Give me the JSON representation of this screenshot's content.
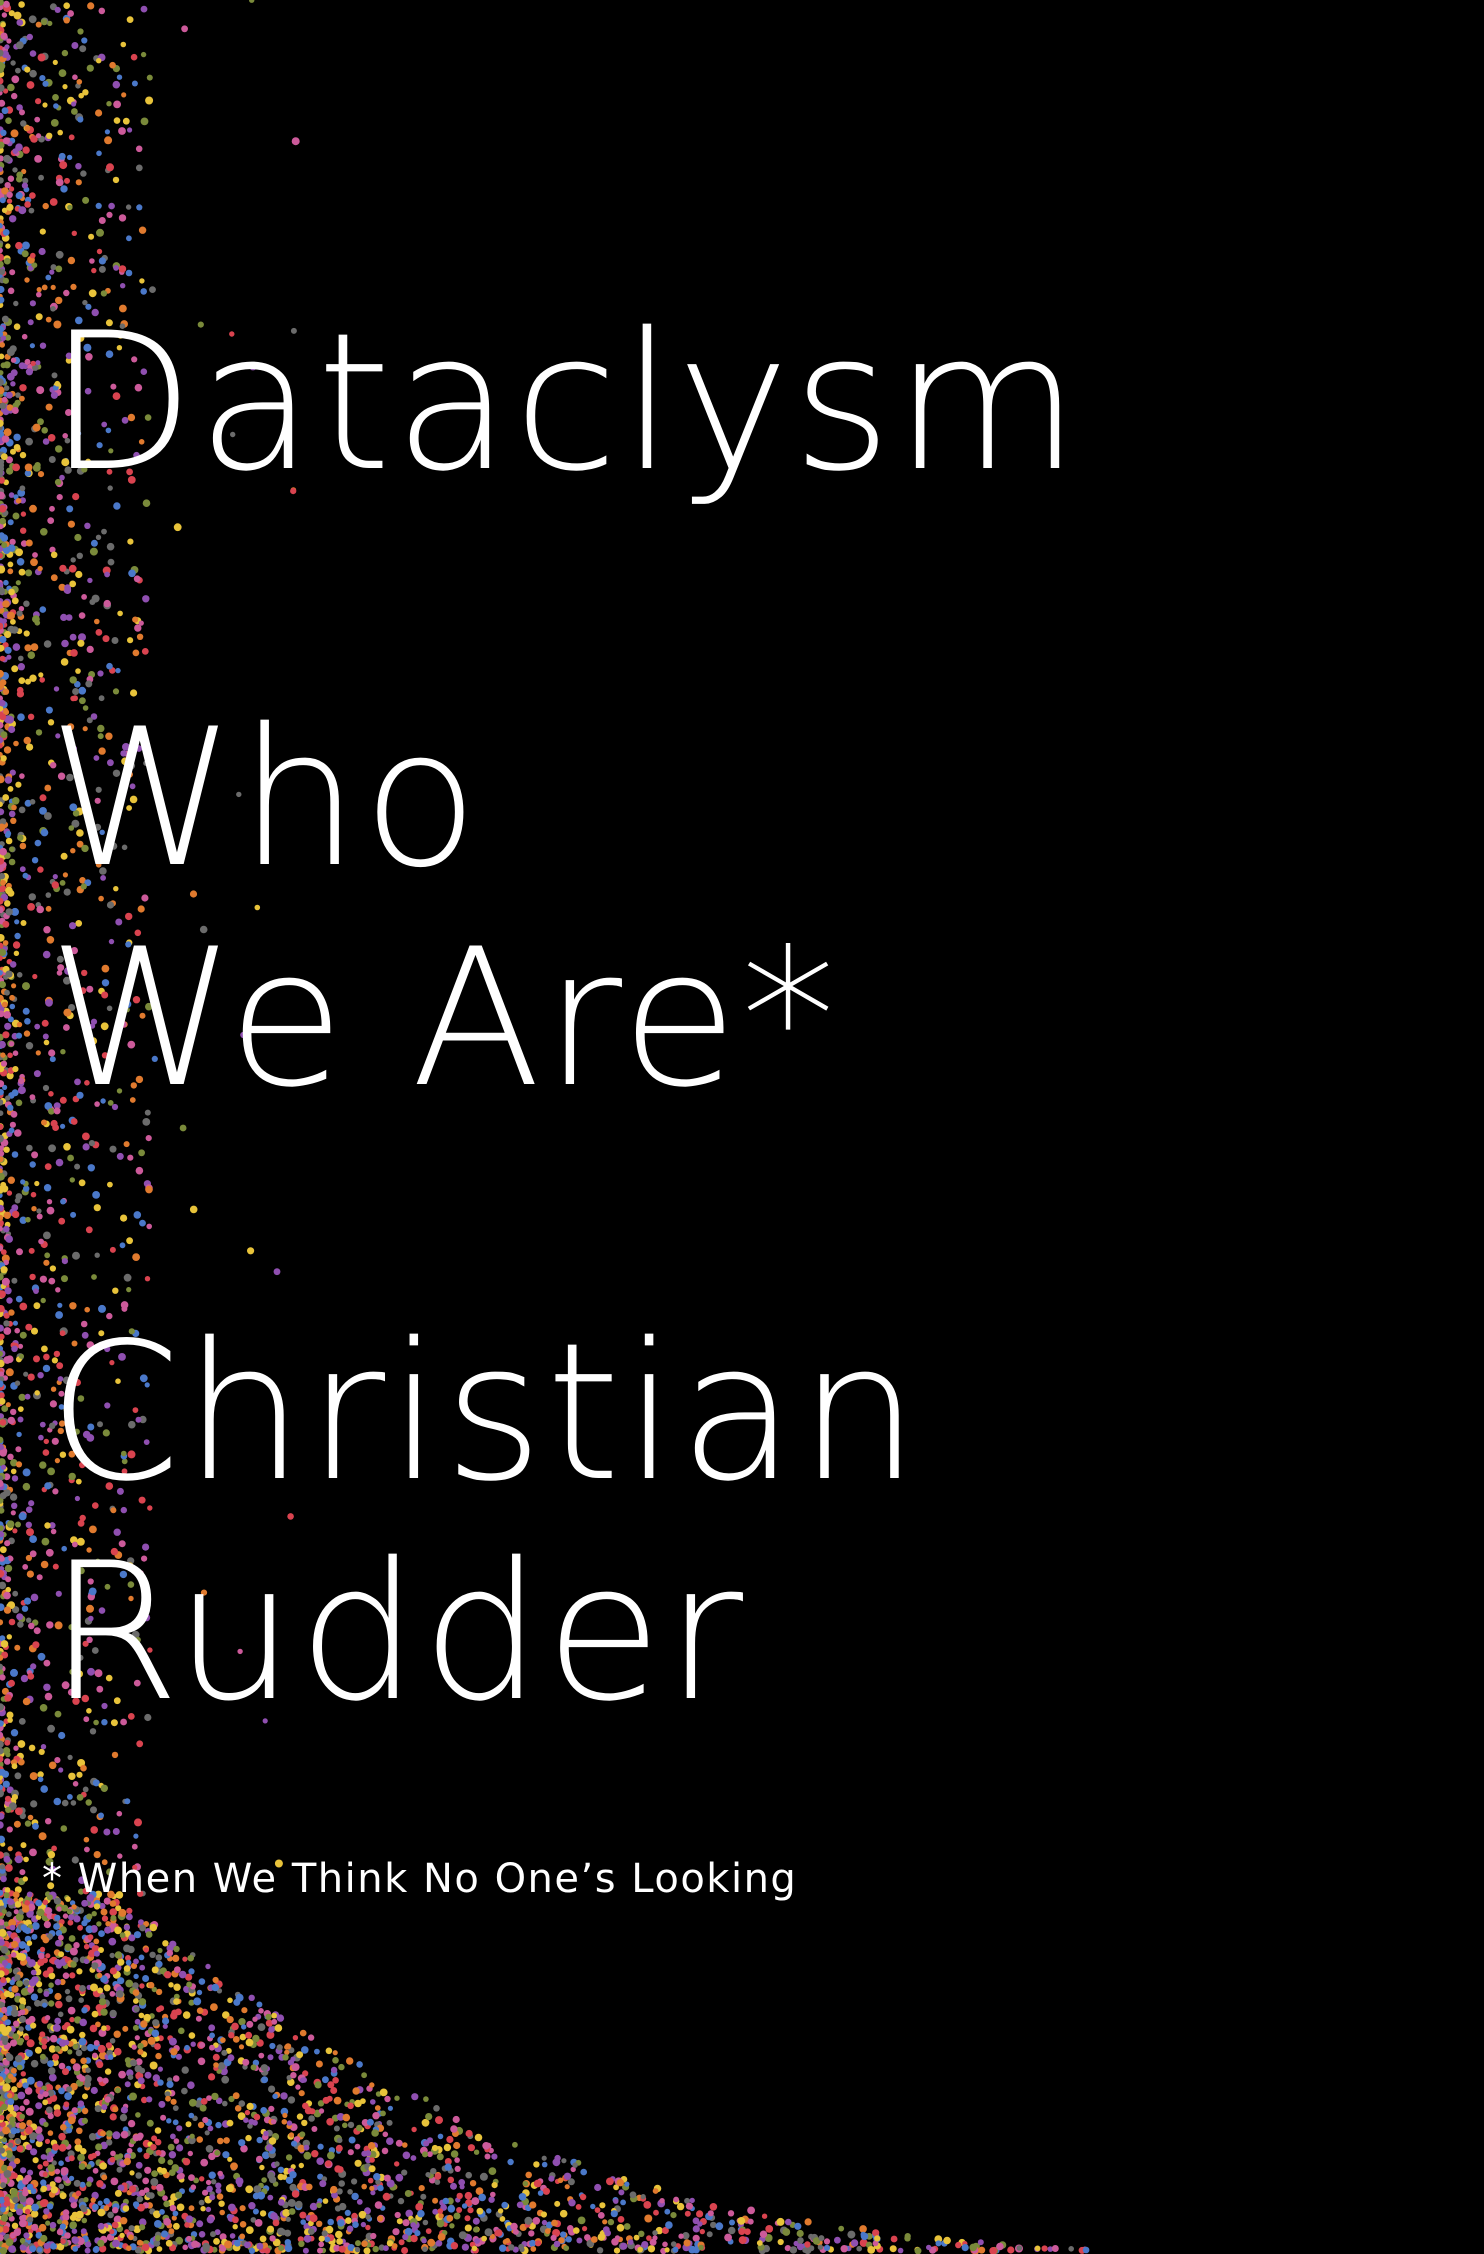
{
  "cover": {
    "title": "Dataclysm",
    "subtitle_line1": "Who",
    "subtitle_line2": "We Are*",
    "author_line1": "Christian",
    "author_line2": "Rudder",
    "footnote": "* When We Think No One’s Looking"
  },
  "colors": {
    "background": "#000000",
    "text": "#ffffff",
    "confetti": [
      "#e8c33a",
      "#d9434f",
      "#4a78c9",
      "#8f4fb0",
      "#e07a2e",
      "#7a8a3a",
      "#6b6b6b",
      "#cc5a9a"
    ]
  }
}
